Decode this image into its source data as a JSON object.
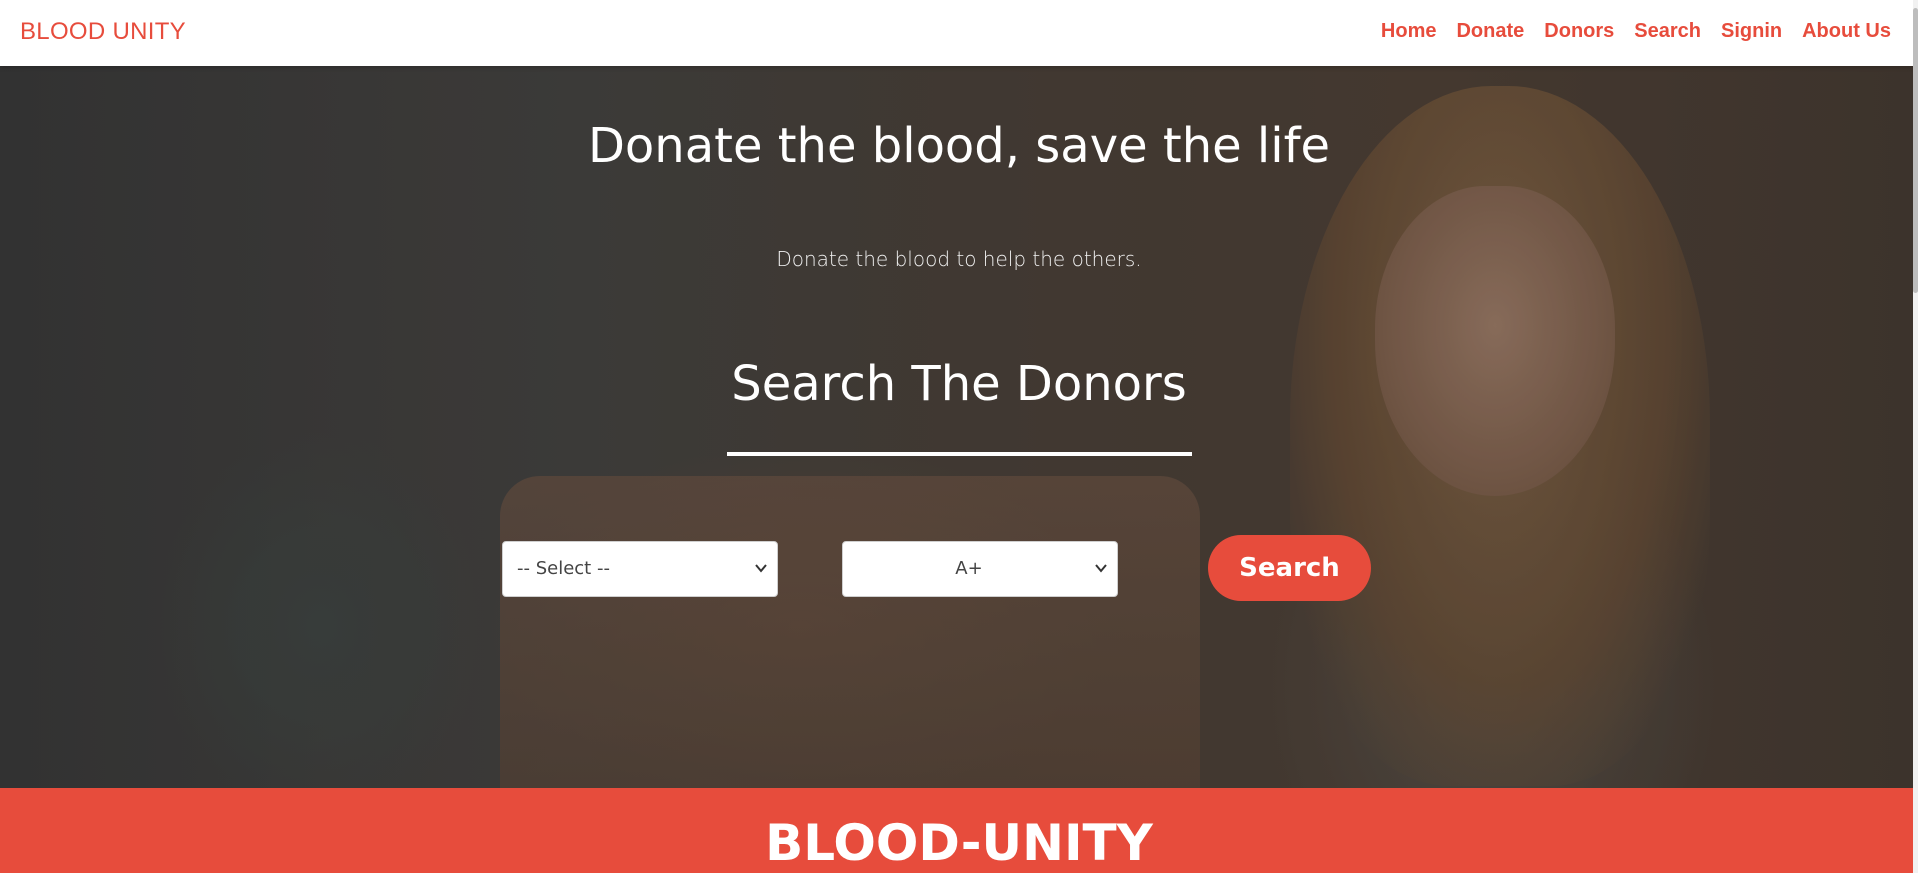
{
  "nav": {
    "brand": "BLOOD UNITY",
    "links": [
      "Home",
      "Donate",
      "Donors",
      "Search",
      "Signin",
      "About Us"
    ]
  },
  "hero": {
    "title": "Donate the blood, save the life",
    "subtitle": "Donate the blood to help the others.",
    "search_title": "Search The Donors"
  },
  "search_form": {
    "city_select": {
      "selected": "-- Select --"
    },
    "blood_group_select": {
      "selected": "A+"
    },
    "button_label": "Search"
  },
  "footer": {
    "brand": "BLOOD-UNITY"
  },
  "colors": {
    "accent": "#e74c3c",
    "nav_bg": "#ffffff",
    "text_light": "#ffffff"
  },
  "icons": {
    "select_chevron": "chevron-down-icon"
  }
}
